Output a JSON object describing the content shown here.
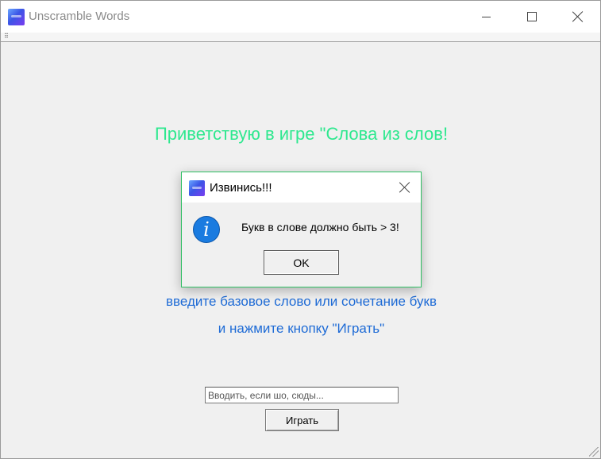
{
  "window": {
    "title": "Unscramble Words",
    "menu_grip": "⠿"
  },
  "main": {
    "welcome": "Приветствую в игре \"Слова из слов!",
    "instruction_line1": "введите базовое слово или сочетание букв",
    "instruction_line2": "и нажмите кнопку \"Играть\"",
    "input_placeholder": "Вводить, если шо, сюды...",
    "input_value": "",
    "play_button": "Играть",
    "colors": {
      "welcome": "#2ee88f",
      "instructions": "#1e6bd6"
    }
  },
  "dialog": {
    "title": "Извинись!!!",
    "message": "Букв в слове должно быть > 3!",
    "ok_button": "OK",
    "icon": "info-icon",
    "icon_glyph": "i",
    "border_color": "#2fbf63"
  }
}
